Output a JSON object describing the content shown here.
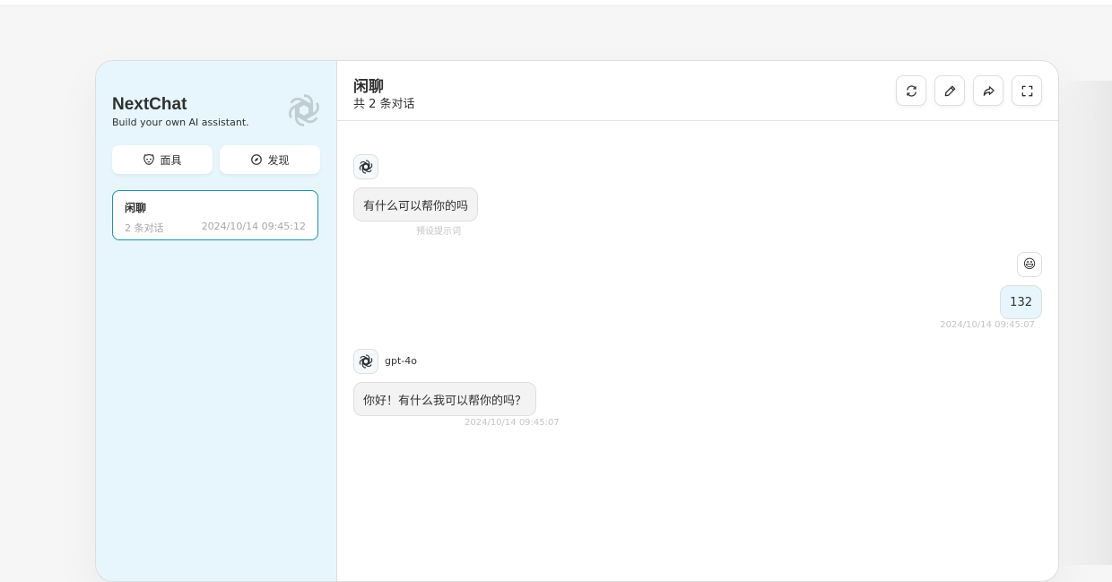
{
  "sidebar": {
    "title": "NextChat",
    "subtitle": "Build your own AI assistant.",
    "mask_button": "面具",
    "discover_button": "发现",
    "chats": [
      {
        "title": "闲聊",
        "count": "2 条对话",
        "date": "2024/10/14 09:45:12"
      }
    ]
  },
  "header": {
    "title": "闲聊",
    "subtitle": "共 2 条对话"
  },
  "messages": [
    {
      "role": "assistant",
      "text": "有什么可以帮你的吗",
      "meta": "预设提示词"
    },
    {
      "role": "user",
      "avatar": "😃",
      "text": "132",
      "meta": "2024/10/14 09:45:07"
    },
    {
      "role": "assistant",
      "model": "gpt-4o",
      "text": "你好！有什么我可以帮你的吗？",
      "meta": "2024/10/14 09:45:07"
    }
  ],
  "icons": {
    "brand": "openai-logo-icon",
    "mask": "mask-icon",
    "discover": "compass-icon",
    "refresh": "refresh-icon",
    "edit": "edit-icon",
    "share": "share-icon",
    "fullscreen": "fullscreen-icon"
  },
  "colors": {
    "sidebar_bg": "#e7f6fd",
    "accent": "#1d93ab",
    "user_bubble": "#e7f6fd",
    "bot_bubble": "#f3f3f3"
  }
}
